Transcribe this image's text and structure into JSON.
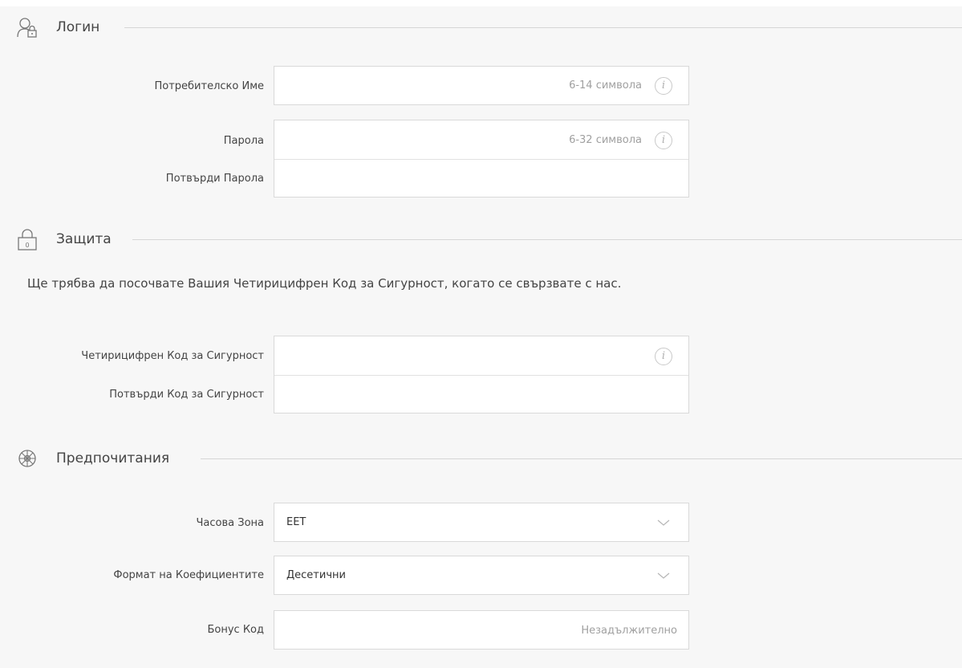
{
  "login": {
    "title": "Логин",
    "icon": "user-lock-icon",
    "username": {
      "label": "Потребителско Име",
      "hint": "6-14 символа",
      "value": ""
    },
    "password": {
      "label": "Парола",
      "hint": "6-32 символа",
      "value": ""
    },
    "confirm_password": {
      "label": "Потвърди Парола",
      "value": ""
    }
  },
  "security": {
    "title": "Защита",
    "icon": "padlock-icon",
    "description": "Ще трябва да посочвате Вашия Четирицифрен Код за Сигурност, когато се свързвате с нас.",
    "code": {
      "label": "Четирицифрен Код за Сигурност",
      "value": ""
    },
    "confirm_code": {
      "label": "Потвърди Код за Сигурност",
      "value": ""
    }
  },
  "preferences": {
    "title": "Предпочитания",
    "icon": "gear-icon",
    "timezone": {
      "label": "Часова Зона",
      "selected": "EET"
    },
    "odds_format": {
      "label": "Формат на Коефициентите",
      "selected": "Десетични"
    },
    "bonus_code": {
      "label": "Бонус Код",
      "placeholder": "Незадължително",
      "value": ""
    }
  },
  "colors": {
    "background": "#f7f7f7",
    "field_bg": "#ffffff",
    "border": "#d9d9d9",
    "hint": "#a0a0a0",
    "text": "#333333"
  }
}
